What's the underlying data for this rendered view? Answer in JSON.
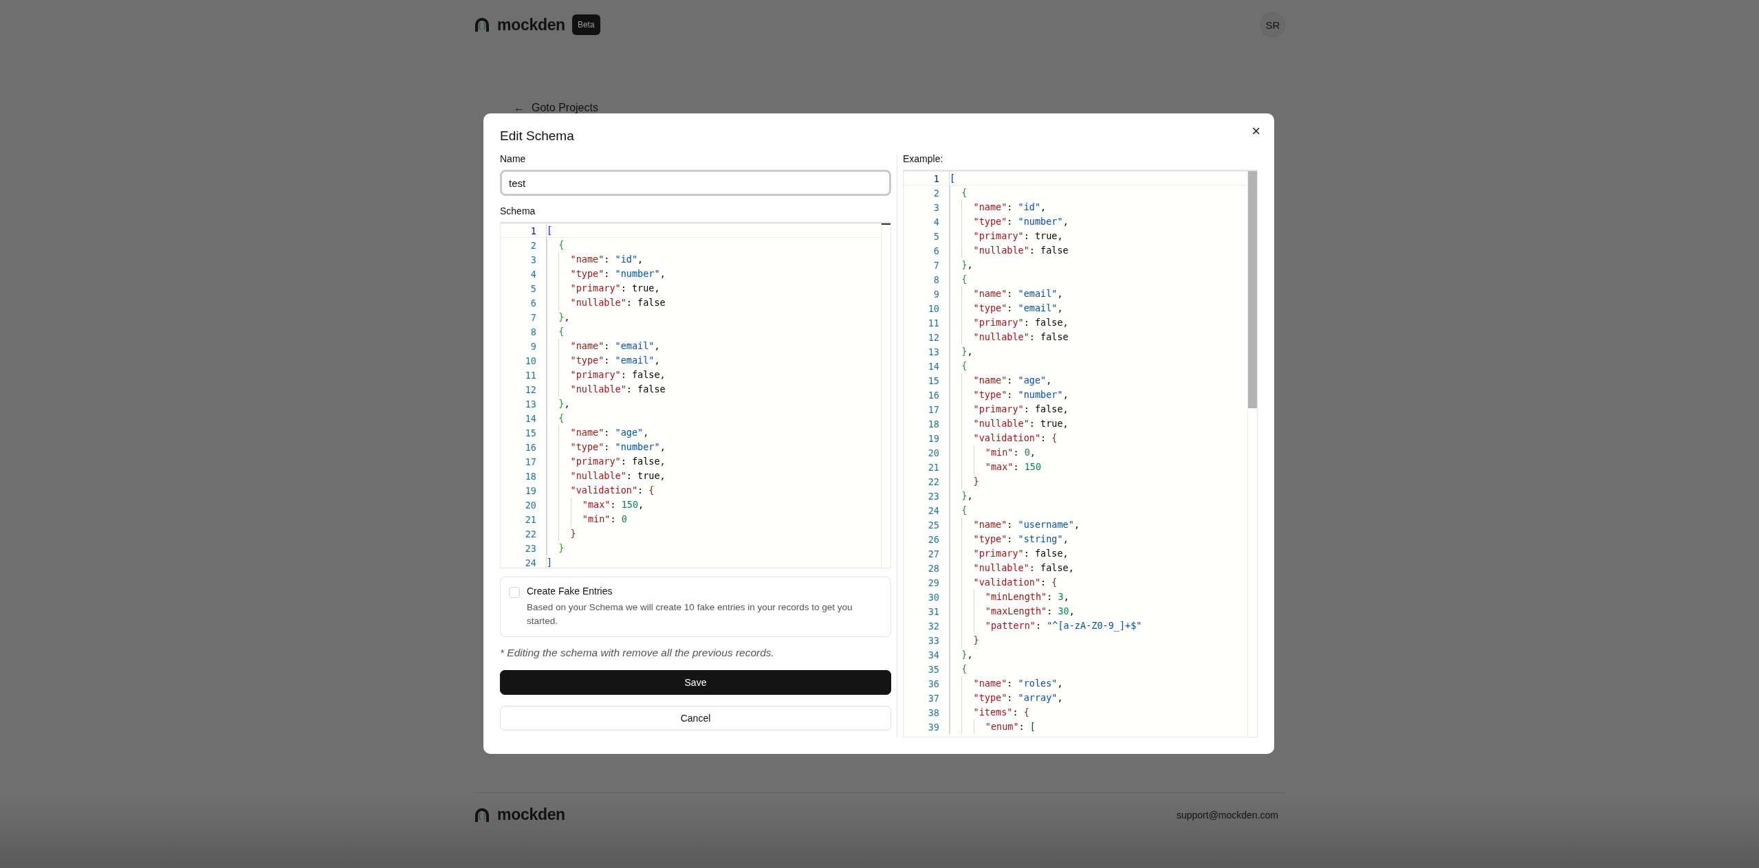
{
  "header": {
    "brand": "mockden",
    "badge": "Beta",
    "avatar": "SR"
  },
  "back_link": {
    "icon": "←",
    "label": "Goto Projects"
  },
  "dialog": {
    "title": "Edit Schema",
    "close": "×",
    "name_field": {
      "label": "Name",
      "value": "test"
    },
    "schema_editor": {
      "label": "Schema",
      "lines": [
        {
          "number": "1",
          "code": "[",
          "selected": true
        },
        {
          "number": "2",
          "code": "  {",
          "selected": false
        },
        {
          "number": "3",
          "code": "    \"name\": \"id\",",
          "selected": false
        },
        {
          "number": "4",
          "code": "    \"type\": \"number\",",
          "selected": false
        },
        {
          "number": "5",
          "code": "    \"primary\": true,",
          "selected": false
        },
        {
          "number": "6",
          "code": "    \"nullable\": false",
          "selected": false
        },
        {
          "number": "7",
          "code": "  },",
          "selected": false
        },
        {
          "number": "8",
          "code": "  {",
          "selected": false
        },
        {
          "number": "9",
          "code": "    \"name\": \"email\",",
          "selected": false
        },
        {
          "number": "10",
          "code": "    \"type\": \"email\",",
          "selected": false
        },
        {
          "number": "11",
          "code": "    \"primary\": false,",
          "selected": false
        },
        {
          "number": "12",
          "code": "    \"nullable\": false",
          "selected": false
        },
        {
          "number": "13",
          "code": "  },",
          "selected": false
        },
        {
          "number": "14",
          "code": "  {",
          "selected": false
        },
        {
          "number": "15",
          "code": "    \"name\": \"age\",",
          "selected": false
        },
        {
          "number": "16",
          "code": "    \"type\": \"number\",",
          "selected": false
        },
        {
          "number": "17",
          "code": "    \"primary\": false,",
          "selected": false
        },
        {
          "number": "18",
          "code": "    \"nullable\": true,",
          "selected": false
        },
        {
          "number": "19",
          "code": "    \"validation\": {",
          "selected": false
        },
        {
          "number": "20",
          "code": "      \"max\": 150,",
          "selected": false
        },
        {
          "number": "21",
          "code": "      \"min\": 0",
          "selected": false
        },
        {
          "number": "22",
          "code": "    }",
          "selected": false
        },
        {
          "number": "23",
          "code": "  }",
          "selected": false
        },
        {
          "number": "24",
          "code": "]",
          "selected": false
        }
      ]
    },
    "fake_entries": {
      "checked": false,
      "title": "Create Fake Entries",
      "description": "Based on your Schema we will create 10 fake entries in your records to get you started."
    },
    "note": "* Editing the schema with remove all the previous records.",
    "buttons": [
      {
        "kind": "primary",
        "label": "Save"
      },
      {
        "kind": "secondary",
        "label": "Cancel"
      }
    ],
    "example_editor": {
      "label": "Example:",
      "lines": [
        {
          "number": "1",
          "code": "[",
          "selected": true
        },
        {
          "number": "2",
          "code": "  {",
          "selected": false
        },
        {
          "number": "3",
          "code": "    \"name\": \"id\",",
          "selected": false
        },
        {
          "number": "4",
          "code": "    \"type\": \"number\",",
          "selected": false
        },
        {
          "number": "5",
          "code": "    \"primary\": true,",
          "selected": false
        },
        {
          "number": "6",
          "code": "    \"nullable\": false",
          "selected": false
        },
        {
          "number": "7",
          "code": "  },",
          "selected": false
        },
        {
          "number": "8",
          "code": "  {",
          "selected": false
        },
        {
          "number": "9",
          "code": "    \"name\": \"email\",",
          "selected": false
        },
        {
          "number": "10",
          "code": "    \"type\": \"email\",",
          "selected": false
        },
        {
          "number": "11",
          "code": "    \"primary\": false,",
          "selected": false
        },
        {
          "number": "12",
          "code": "    \"nullable\": false",
          "selected": false
        },
        {
          "number": "13",
          "code": "  },",
          "selected": false
        },
        {
          "number": "14",
          "code": "  {",
          "selected": false
        },
        {
          "number": "15",
          "code": "    \"name\": \"age\",",
          "selected": false
        },
        {
          "number": "16",
          "code": "    \"type\": \"number\",",
          "selected": false
        },
        {
          "number": "17",
          "code": "    \"primary\": false,",
          "selected": false
        },
        {
          "number": "18",
          "code": "    \"nullable\": true,",
          "selected": false
        },
        {
          "number": "19",
          "code": "    \"validation\": {",
          "selected": false
        },
        {
          "number": "20",
          "code": "      \"min\": 0,",
          "selected": false
        },
        {
          "number": "21",
          "code": "      \"max\": 150",
          "selected": false
        },
        {
          "number": "22",
          "code": "    }",
          "selected": false
        },
        {
          "number": "23",
          "code": "  },",
          "selected": false
        },
        {
          "number": "24",
          "code": "  {",
          "selected": false
        },
        {
          "number": "25",
          "code": "    \"name\": \"username\",",
          "selected": false
        },
        {
          "number": "26",
          "code": "    \"type\": \"string\",",
          "selected": false
        },
        {
          "number": "27",
          "code": "    \"primary\": false,",
          "selected": false
        },
        {
          "number": "28",
          "code": "    \"nullable\": false,",
          "selected": false
        },
        {
          "number": "29",
          "code": "    \"validation\": {",
          "selected": false
        },
        {
          "number": "30",
          "code": "      \"minLength\": 3,",
          "selected": false
        },
        {
          "number": "31",
          "code": "      \"maxLength\": 30,",
          "selected": false
        },
        {
          "number": "32",
          "code": "      \"pattern\": \"^[a-zA-Z0-9_]+$\"",
          "selected": false
        },
        {
          "number": "33",
          "code": "    }",
          "selected": false
        },
        {
          "number": "34",
          "code": "  },",
          "selected": false
        },
        {
          "number": "35",
          "code": "  {",
          "selected": false
        },
        {
          "number": "36",
          "code": "    \"name\": \"roles\",",
          "selected": false
        },
        {
          "number": "37",
          "code": "    \"type\": \"array\",",
          "selected": false
        },
        {
          "number": "38",
          "code": "    \"items\": {",
          "selected": false
        },
        {
          "number": "39",
          "code": "      \"enum\": [",
          "selected": false
        }
      ]
    }
  },
  "footer": {
    "brand": "mockden",
    "email": "support@mockden.com"
  }
}
